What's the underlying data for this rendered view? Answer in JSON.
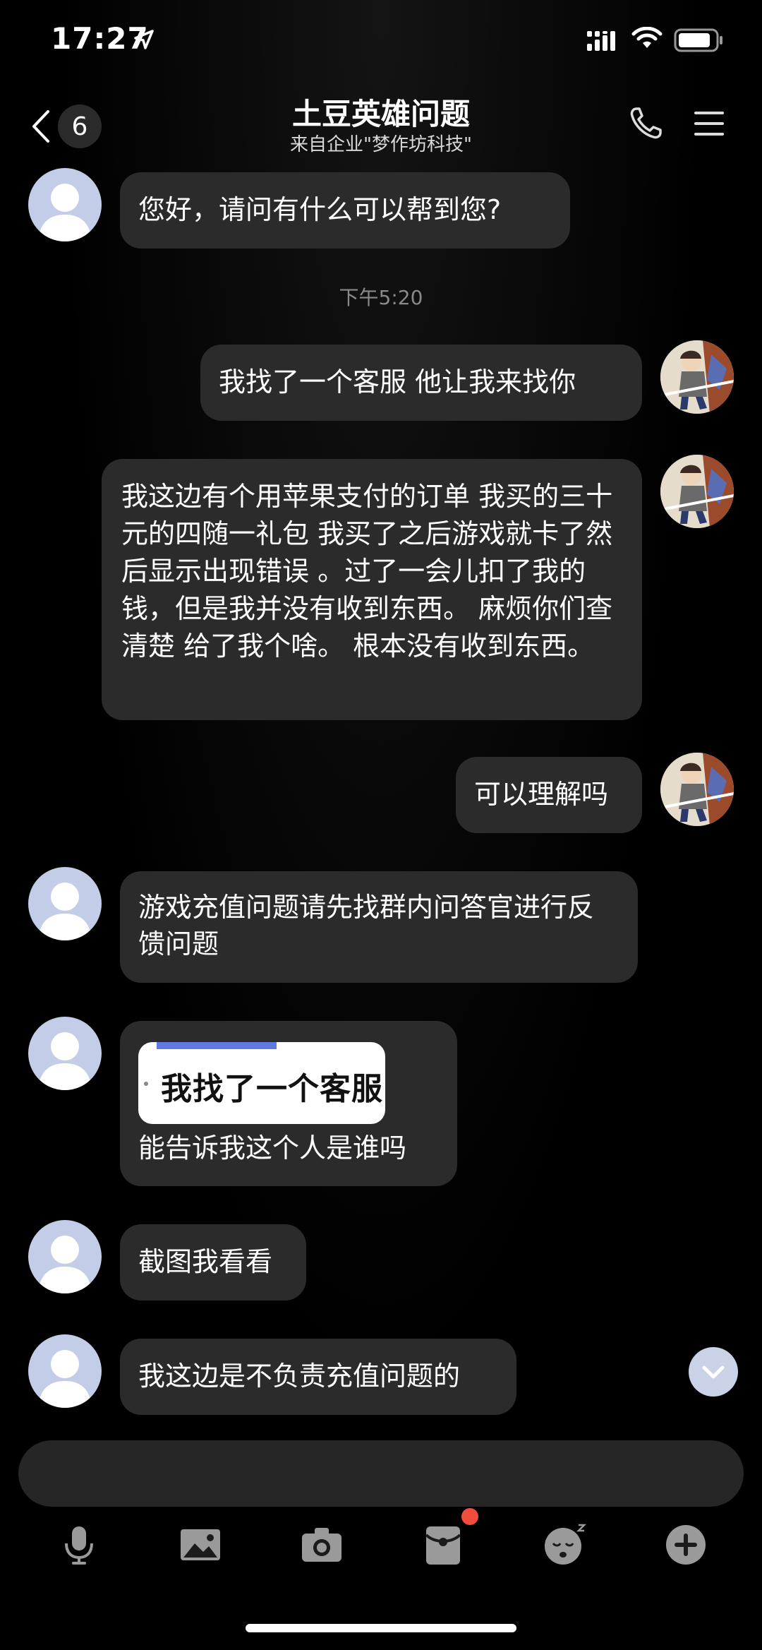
{
  "status_bar": {
    "time": "17:27"
  },
  "header": {
    "back_count": "6",
    "title": "土豆英雄问题",
    "subtitle": "来自企业\"梦作坊科技\""
  },
  "messages": {
    "m1": "您好，请问有什么可以帮到您?",
    "timestamp": "下午5:20",
    "m2": "我找了一个客服  他让我来找你",
    "m3": "我这边有个用苹果支付的订单 我买的三十元的四随一礼包 我买了之后游戏就卡了然后显示出现错误 。过了一会儿扣了我的钱，但是我并没有收到东西。 麻烦你们查清楚 给了我个啥。 根本没有收到东西。",
    "m4": "可以理解吗",
    "m5": "游戏充值问题请先找群内问答官进行反馈问题",
    "m6_image_text": "我找了一个客服",
    "m6": "能告诉我这个人是谁吗",
    "m7": "截图我看看",
    "m8": "我这边是不负责充值问题的"
  },
  "icons": {
    "toolbar": [
      "microphone-icon",
      "image-icon",
      "camera-icon",
      "red-packet-icon",
      "emoji-icon",
      "plus-icon"
    ]
  },
  "colors": {
    "bubble": "#2b2b2b",
    "background": "#000000",
    "notification_dot": "#f24c3d"
  }
}
